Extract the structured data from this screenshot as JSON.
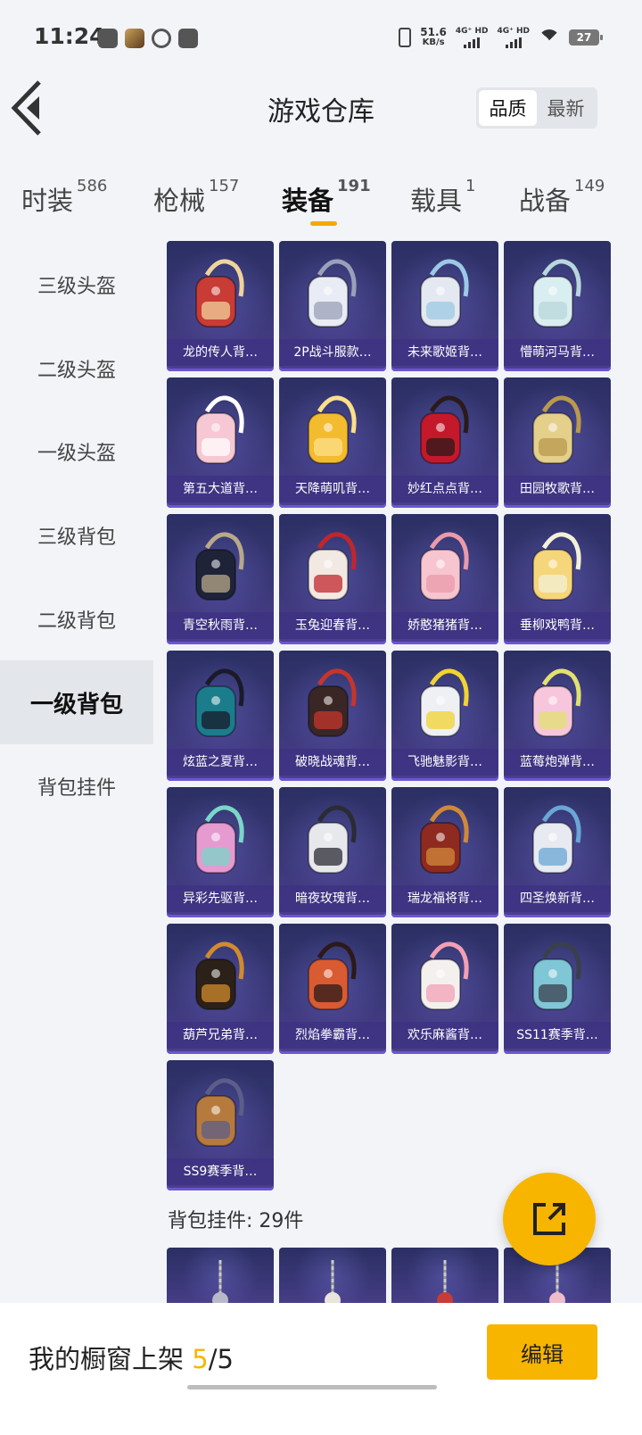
{
  "status_bar": {
    "time": "11:24",
    "net_speed_value": "51.6",
    "net_speed_unit": "KB/s",
    "sig1": "4G⁺ HD",
    "sig2": "4G⁺ HD",
    "battery": "27"
  },
  "header": {
    "title": "游戏仓库",
    "sort_quality": "品质",
    "sort_newest": "最新"
  },
  "tabs": [
    {
      "label": "时装",
      "count": "586"
    },
    {
      "label": "枪械",
      "count": "157"
    },
    {
      "label": "装备",
      "count": "191"
    },
    {
      "label": "载具",
      "count": "1"
    },
    {
      "label": "战备",
      "count": "149"
    }
  ],
  "sidebar": [
    "三级头盔",
    "二级头盔",
    "一级头盔",
    "三级背包",
    "二级背包",
    "一级背包",
    "背包挂件"
  ],
  "items": [
    {
      "name": "龙的传人背…",
      "color": "#c93b35",
      "accent": "#f0d39a"
    },
    {
      "name": "2P战斗服款…",
      "color": "#e9ecf4",
      "accent": "#9aa0b8"
    },
    {
      "name": "未来歌姬背…",
      "color": "#e4e8f0",
      "accent": "#9cc9e6"
    },
    {
      "name": "懵萌河马背…",
      "color": "#d9eef0",
      "accent": "#b8d7da"
    },
    {
      "name": "第五大道背…",
      "color": "#f6c8d4",
      "accent": "#ffffff"
    },
    {
      "name": "天降萌叽背…",
      "color": "#f3bb2e",
      "accent": "#fce08a"
    },
    {
      "name": "妙红点点背…",
      "color": "#c3192b",
      "accent": "#2a1a1a"
    },
    {
      "name": "田园牧歌背…",
      "color": "#e4cf8b",
      "accent": "#b99a4c"
    },
    {
      "name": "青空秋雨背…",
      "color": "#1e2338",
      "accent": "#b9a88a"
    },
    {
      "name": "玉兔迎春背…",
      "color": "#f1e9e2",
      "accent": "#c0262c"
    },
    {
      "name": "娇憨猪猪背…",
      "color": "#f6c5cf",
      "accent": "#e99aab"
    },
    {
      "name": "垂柳戏鸭背…",
      "color": "#f6d67a",
      "accent": "#f3f0d8"
    },
    {
      "name": "炫蓝之夏背…",
      "color": "#1b7d8c",
      "accent": "#1a1a2a"
    },
    {
      "name": "破晓战魂背…",
      "color": "#3b2626",
      "accent": "#c5352c"
    },
    {
      "name": "飞驰魅影背…",
      "color": "#eef0f4",
      "accent": "#f1d332"
    },
    {
      "name": "蓝莓炮弹背…",
      "color": "#f7c6dc",
      "accent": "#e2e070"
    },
    {
      "name": "异彩先驱背…",
      "color": "#e59ad0",
      "accent": "#7ad6c8"
    },
    {
      "name": "暗夜玫瑰背…",
      "color": "#e7e8ec",
      "accent": "#2b2b34"
    },
    {
      "name": "瑞龙福将背…",
      "color": "#8f2a20",
      "accent": "#d0893a"
    },
    {
      "name": "四圣焕新背…",
      "color": "#e7eaf0",
      "accent": "#6aa6d6"
    },
    {
      "name": "葫芦兄弟背…",
      "color": "#2c2118",
      "accent": "#d18b2c"
    },
    {
      "name": "烈焰拳霸背…",
      "color": "#d95b31",
      "accent": "#2b1a1a"
    },
    {
      "name": "欢乐麻酱背…",
      "color": "#f4f0ee",
      "accent": "#f3a0b4"
    },
    {
      "name": "SS11赛季背…",
      "color": "#7fc6d6",
      "accent": "#3a3f4c"
    },
    {
      "name": "SS9赛季背…",
      "color": "#b77a3e",
      "accent": "#5c5e8a"
    }
  ],
  "pendant_section": {
    "title": "背包挂件: 29件"
  },
  "pendants": [
    {
      "color": "#b8b8c8"
    },
    {
      "color": "#e9e4dc"
    },
    {
      "color": "#c93b35"
    },
    {
      "color": "#f0bccb"
    }
  ],
  "bottom_bar": {
    "shelf_label": "我的橱窗上架",
    "shelf_current": "5",
    "shelf_total": "/5",
    "edit_label": "编辑"
  }
}
